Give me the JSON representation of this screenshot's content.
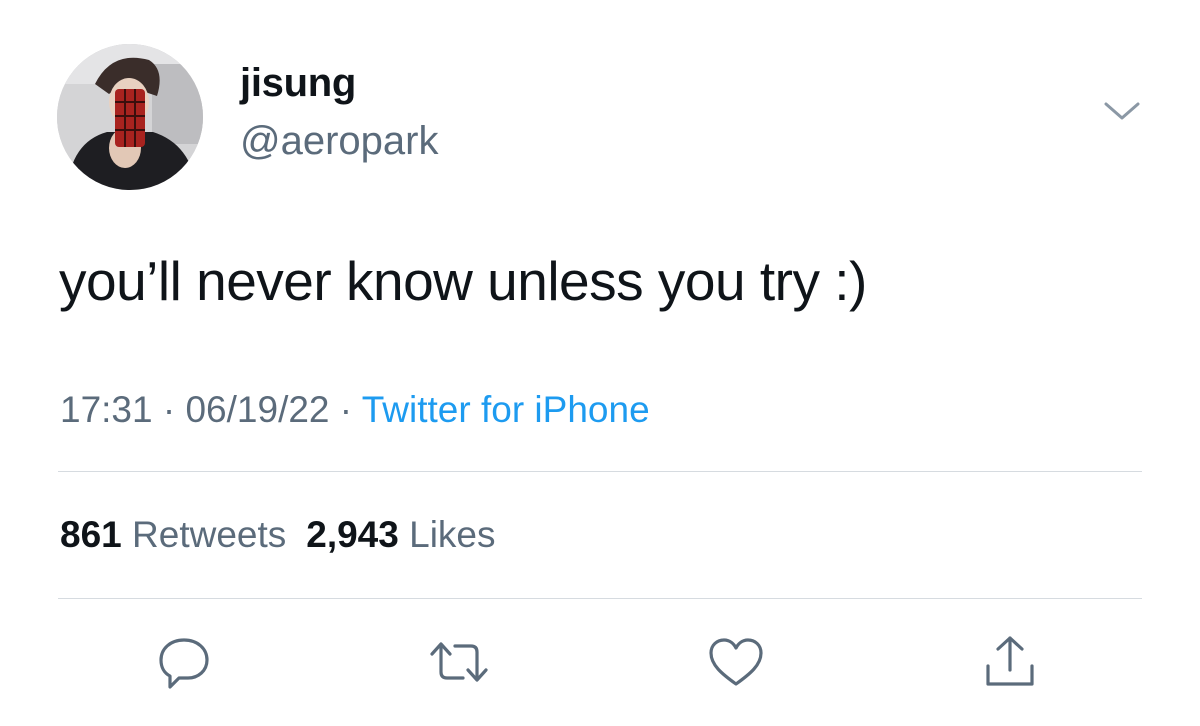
{
  "author": {
    "display_name": "jisung",
    "handle": "@aeropark"
  },
  "tweet": {
    "text": "you’ll never know unless you try :)",
    "time": "17:31",
    "date": "06/19/22",
    "separator": " · ",
    "source": "Twitter for iPhone"
  },
  "stats": {
    "retweets_count": "861",
    "retweets_label": "Retweets",
    "likes_count": "2,943",
    "likes_label": "Likes"
  },
  "actions": [
    {
      "name": "reply",
      "icon": "speech-bubble-icon"
    },
    {
      "name": "retweet",
      "icon": "retweet-arrows-icon"
    },
    {
      "name": "like",
      "icon": "heart-icon"
    },
    {
      "name": "share",
      "icon": "share-upload-icon"
    }
  ],
  "colors": {
    "text": "#0f1419",
    "secondary": "#5b6b7b",
    "link": "#1d9bf0",
    "divider": "#d6dbe0"
  }
}
